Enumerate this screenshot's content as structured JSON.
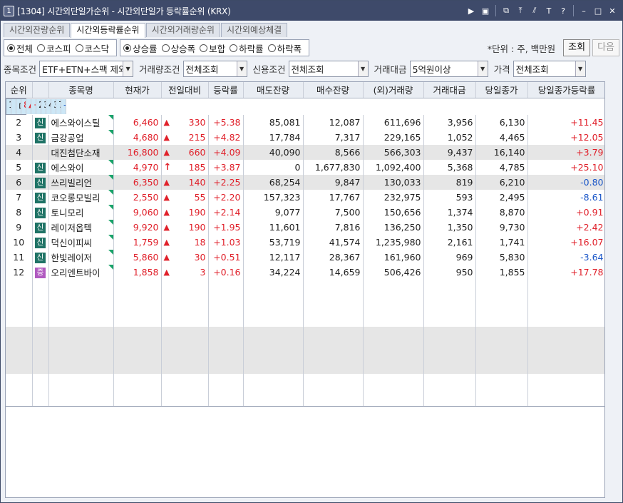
{
  "window": {
    "number_badge": "1",
    "title": "[1304] 시간외단일가순위 - 시간외단일가 등락률순위 (KRX)"
  },
  "tabs": [
    "시간외잔량순위",
    "시간외등락률순위",
    "시간외거래량순위",
    "시간외예상체결"
  ],
  "market_radios": [
    "전체",
    "코스피",
    "코스닥"
  ],
  "sort_radios": [
    "상승률",
    "상승폭",
    "보합",
    "하락률",
    "하락폭"
  ],
  "unit_label": "*단위 : 주, 백만원",
  "buttons": {
    "query": "조회",
    "next": "다음"
  },
  "filters": {
    "stock_cond_label": "종목조건",
    "stock_cond": "ETF+ETN+스팩 제외",
    "volume_cond_label": "거래량조건",
    "volume_cond": "전체조회",
    "credit_cond_label": "신용조건",
    "credit_cond": "전체조회",
    "amount_label": "거래대금",
    "amount": "5억원이상",
    "price_label": "가격",
    "price": "전체조회"
  },
  "columns": [
    "순위",
    "",
    "종목명",
    "현재가",
    "전일대비",
    "등락률",
    "매도잔량",
    "매수잔량",
    "(외)거래량",
    "거래대금",
    "당일종가",
    "당일종가등락률"
  ],
  "rows": [
    {
      "rank": "1",
      "badge": "",
      "name": "더존",
      "price": "8,350",
      "arrow": "▲",
      "diff": "480",
      "rate": "+6.10",
      "sell": "20,139",
      "buy": "31,299",
      "vol": "451,353",
      "amt": "3,728",
      "close": "7,870",
      "crate": "-1.99"
    },
    {
      "rank": "2",
      "badge": "신",
      "name": "에스와이스틸",
      "price": "6,460",
      "arrow": "▲",
      "diff": "330",
      "rate": "+5.38",
      "sell": "85,081",
      "buy": "12,087",
      "vol": "611,696",
      "amt": "3,956",
      "close": "6,130",
      "crate": "+11.45"
    },
    {
      "rank": "3",
      "badge": "신",
      "name": "금강공업",
      "price": "4,680",
      "arrow": "▲",
      "diff": "215",
      "rate": "+4.82",
      "sell": "17,784",
      "buy": "7,317",
      "vol": "229,165",
      "amt": "1,052",
      "close": "4,465",
      "crate": "+12.05"
    },
    {
      "rank": "4",
      "badge": "",
      "name": "대진첨단소재",
      "price": "16,800",
      "arrow": "▲",
      "diff": "660",
      "rate": "+4.09",
      "sell": "40,090",
      "buy": "8,566",
      "vol": "566,303",
      "amt": "9,437",
      "close": "16,140",
      "crate": "+3.79"
    },
    {
      "rank": "5",
      "badge": "신",
      "name": "에스와이",
      "price": "4,970",
      "arrow": "↑",
      "diff": "185",
      "rate": "+3.87",
      "sell": "0",
      "buy": "1,677,830",
      "vol": "1,092,400",
      "amt": "5,368",
      "close": "4,785",
      "crate": "+25.10"
    },
    {
      "rank": "6",
      "badge": "신",
      "name": "쓰리빌리언",
      "price": "6,350",
      "arrow": "▲",
      "diff": "140",
      "rate": "+2.25",
      "sell": "68,254",
      "buy": "9,847",
      "vol": "130,033",
      "amt": "819",
      "close": "6,210",
      "crate": "-0.80"
    },
    {
      "rank": "7",
      "badge": "신",
      "name": "코오롱모빌리",
      "price": "2,550",
      "arrow": "▲",
      "diff": "55",
      "rate": "+2.20",
      "sell": "157,323",
      "buy": "17,767",
      "vol": "232,975",
      "amt": "593",
      "close": "2,495",
      "crate": "-8.61"
    },
    {
      "rank": "8",
      "badge": "신",
      "name": "토니모리",
      "price": "9,060",
      "arrow": "▲",
      "diff": "190",
      "rate": "+2.14",
      "sell": "9,077",
      "buy": "7,500",
      "vol": "150,656",
      "amt": "1,374",
      "close": "8,870",
      "crate": "+0.91"
    },
    {
      "rank": "9",
      "badge": "신",
      "name": "레이저옵텍",
      "price": "9,920",
      "arrow": "▲",
      "diff": "190",
      "rate": "+1.95",
      "sell": "11,601",
      "buy": "7,816",
      "vol": "136,250",
      "amt": "1,350",
      "close": "9,730",
      "crate": "+2.42"
    },
    {
      "rank": "10",
      "badge": "신",
      "name": "덕신이피씨",
      "price": "1,759",
      "arrow": "▲",
      "diff": "18",
      "rate": "+1.03",
      "sell": "53,719",
      "buy": "41,574",
      "vol": "1,235,980",
      "amt": "2,161",
      "close": "1,741",
      "crate": "+16.07"
    },
    {
      "rank": "11",
      "badge": "신",
      "name": "한빛레이저",
      "price": "5,860",
      "arrow": "▲",
      "diff": "30",
      "rate": "+0.51",
      "sell": "12,117",
      "buy": "28,367",
      "vol": "161,960",
      "amt": "969",
      "close": "5,830",
      "crate": "-3.64"
    },
    {
      "rank": "12",
      "badge": "증",
      "name": "오리엔트바이",
      "price": "1,858",
      "arrow": "▲",
      "diff": "3",
      "rate": "+0.16",
      "sell": "34,224",
      "buy": "14,659",
      "vol": "506,426",
      "amt": "950",
      "close": "1,855",
      "crate": "+17.78"
    }
  ],
  "colors": {
    "up": "#e0202a",
    "down": "#1a56c8",
    "credit_badge": "#1f7366",
    "warn_badge": "#b05ac0",
    "title_bar": "#3e4a6a",
    "selected_row": "#cde7f6"
  }
}
